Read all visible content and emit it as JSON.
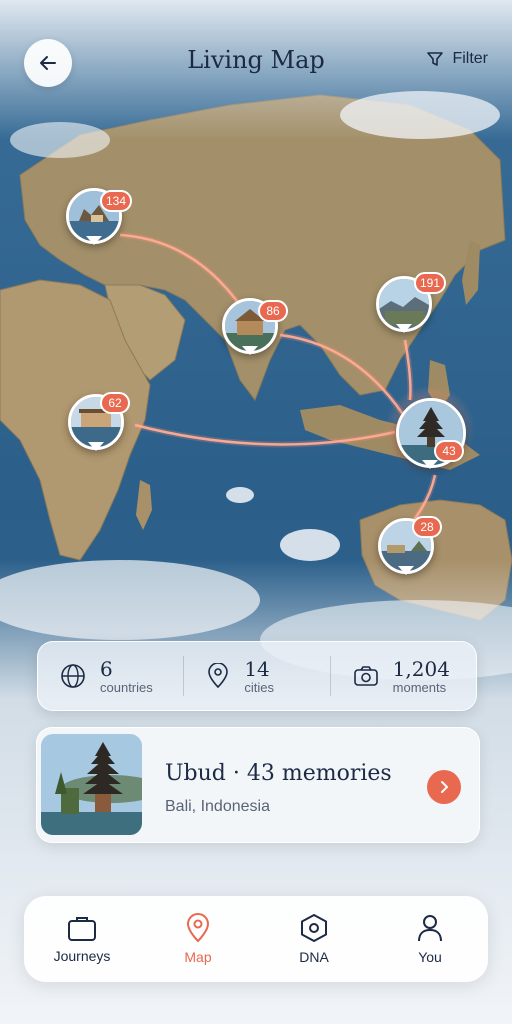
{
  "header": {
    "title": "Living Map",
    "filter_label": "Filter"
  },
  "pins": [
    {
      "name": "pin-europe",
      "count": "134"
    },
    {
      "name": "pin-india",
      "count": "86"
    },
    {
      "name": "pin-china",
      "count": "191"
    },
    {
      "name": "pin-africa",
      "count": "62"
    },
    {
      "name": "pin-bali",
      "count": "43"
    },
    {
      "name": "pin-australia",
      "count": "28"
    }
  ],
  "stats": [
    {
      "value": "6",
      "label": "countries",
      "icon": "globe-icon"
    },
    {
      "value": "14",
      "label": "cities",
      "icon": "location-pin-icon"
    },
    {
      "value": "1,204",
      "label": "moments",
      "icon": "camera-icon"
    }
  ],
  "place": {
    "title": "Ubud · 43 memories",
    "subtitle": "Bali, Indonesia"
  },
  "tabs": [
    {
      "label": "Journeys",
      "icon": "briefcase-icon"
    },
    {
      "label": "Map",
      "icon": "location-pin-icon",
      "active": true
    },
    {
      "label": "DNA",
      "icon": "hexagon-icon"
    },
    {
      "label": "You",
      "icon": "user-icon"
    }
  ],
  "colors": {
    "accent": "#e8694f",
    "text": "#1c2a44",
    "ocean": "#2a5c85",
    "land": "#a8926a"
  }
}
